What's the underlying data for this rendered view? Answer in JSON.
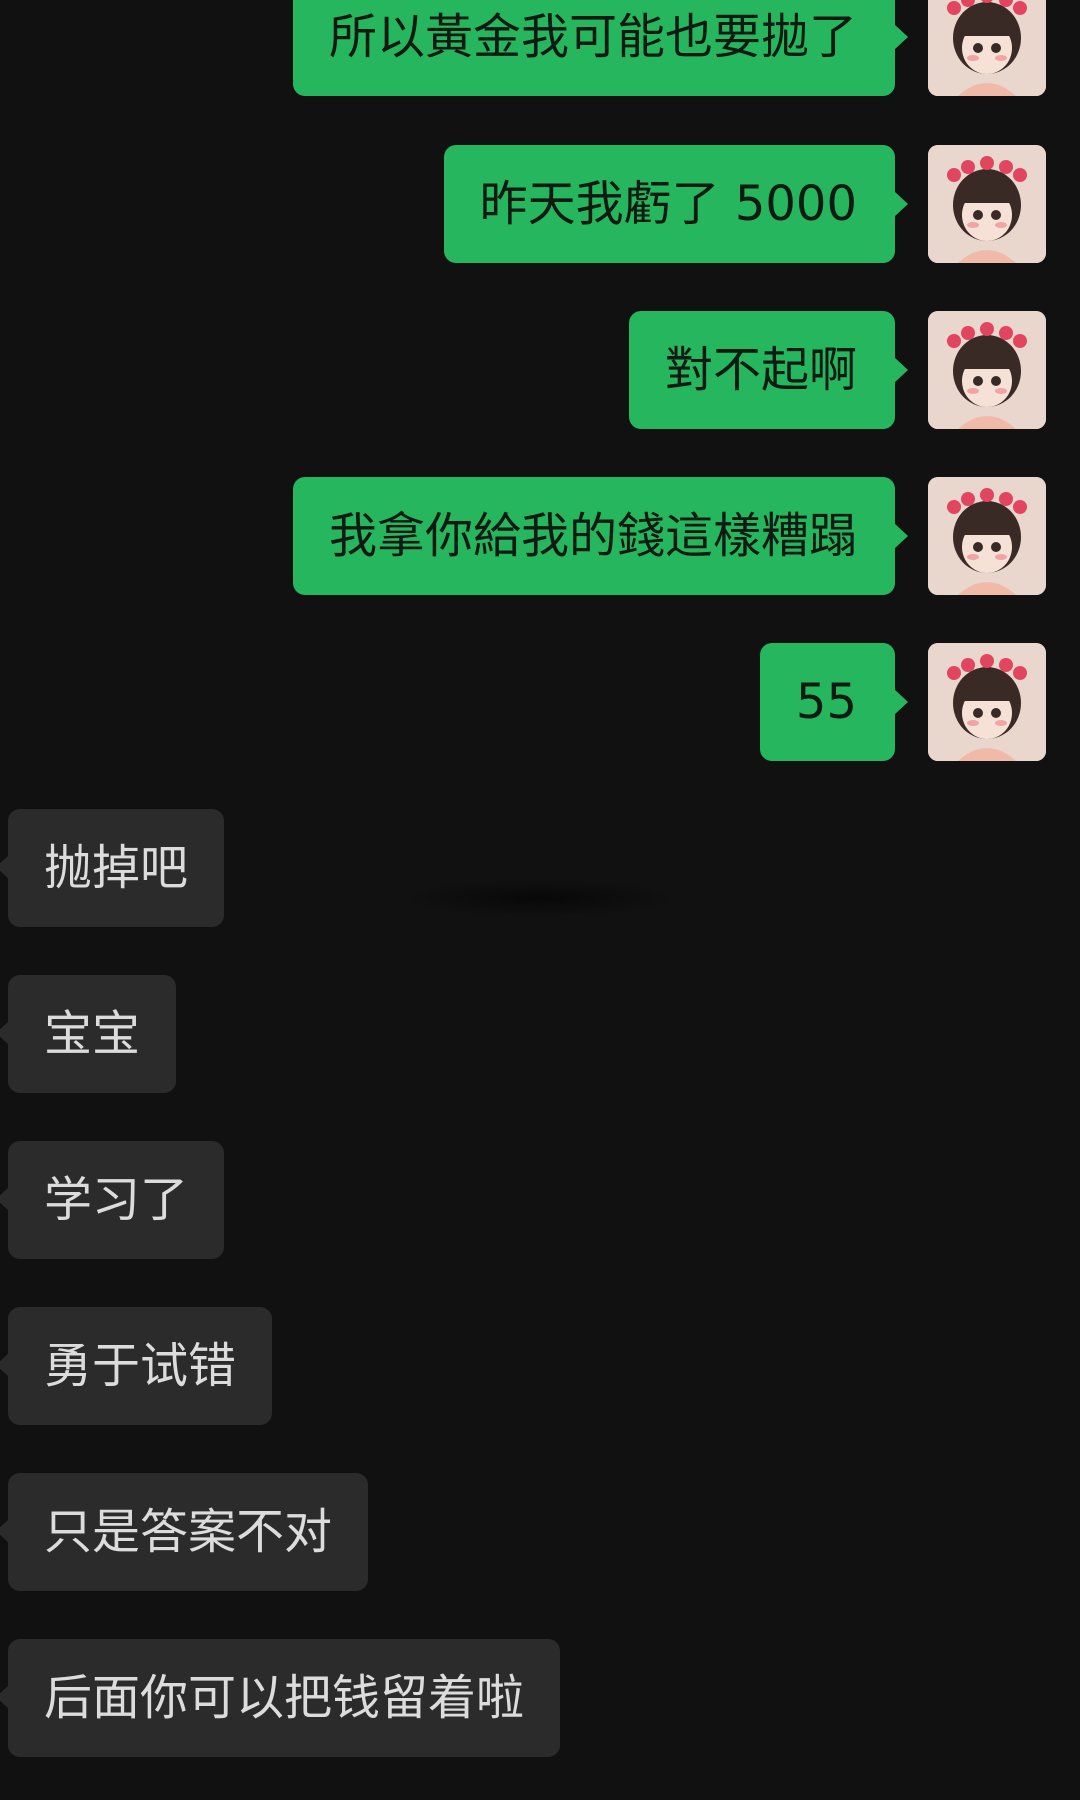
{
  "messages": [
    {
      "side": "out",
      "text": "所以黃金我可能也要拋了"
    },
    {
      "side": "out",
      "text": "昨天我虧了 5000"
    },
    {
      "side": "out",
      "text": "對不起啊"
    },
    {
      "side": "out",
      "text": "我拿你給我的錢這樣糟蹋"
    },
    {
      "side": "out",
      "text": "55"
    },
    {
      "side": "in",
      "text": "抛掉吧"
    },
    {
      "side": "in",
      "text": "宝宝"
    },
    {
      "side": "in",
      "text": "学习了"
    },
    {
      "side": "in",
      "text": "勇于试错"
    },
    {
      "side": "in",
      "text": "只是答案不对"
    },
    {
      "side": "in",
      "text": "后面你可以把钱留着啦"
    }
  ],
  "avatar": {
    "icon": "anime-girl-avatar-icon"
  },
  "colors": {
    "background": "#111111",
    "outgoing_bubble": "#26b65e",
    "incoming_bubble": "#2b2b2b"
  }
}
